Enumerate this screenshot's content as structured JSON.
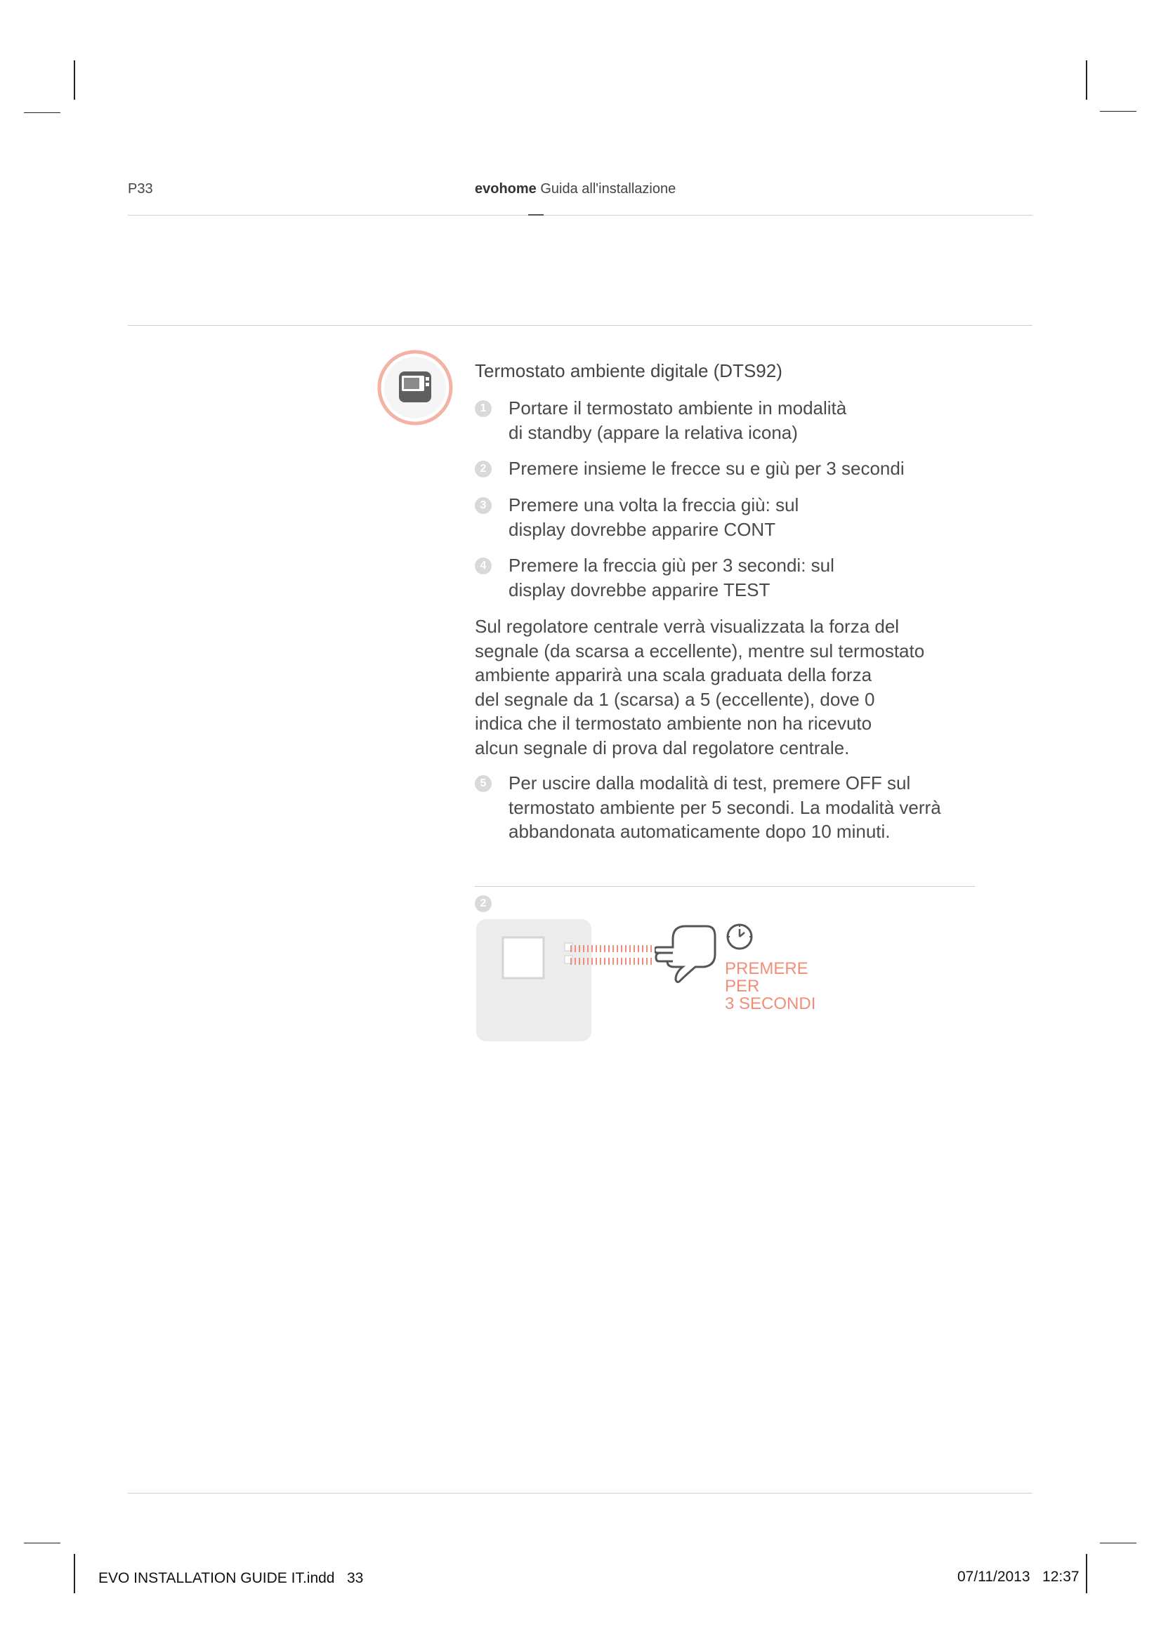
{
  "header": {
    "page_label": "P33",
    "brand": "evohome",
    "guide_title": "Guida all'installazione"
  },
  "section": {
    "icon": "thermostat-device-icon",
    "title": "Termostato ambiente digitale (DTS92)",
    "steps": [
      {
        "num": "1",
        "text": "Portare il termostato ambiente in modalità\ndi standby (appare la relativa icona)"
      },
      {
        "num": "2",
        "text": "Premere insieme le frecce su e giù per 3 secondi"
      },
      {
        "num": "3",
        "text": "Premere una volta la freccia giù: sul\ndisplay dovrebbe apparire CONT"
      },
      {
        "num": "4",
        "text": "Premere la freccia giù per 3 secondi: sul\ndisplay dovrebbe apparire TEST"
      }
    ],
    "paragraph": "Sul regolatore centrale verrà visualizzata la forza del\nsegnale (da scarsa a eccellente), mentre sul termostato\nambiente apparirà una scala graduata della forza\ndel segnale da 1 (scarsa) a 5 (eccellente), dove 0\nindica che il termostato ambiente non ha ricevuto\nalcun segnale di prova dal regolatore centrale.",
    "step5": {
      "num": "5",
      "text": "Per uscire dalla modalità di test, premere OFF sul\ntermostato ambiente per 5 secondi. La modalità verrà\nabbandonata automaticamente dopo 10 minuti."
    }
  },
  "figure": {
    "step_num": "2",
    "press_text": "PREMERE\nPER\n3 SECONDI",
    "accent_color": "#f08e7a"
  },
  "footer": {
    "file": "EVO INSTALLATION GUIDE IT.indd   33",
    "datetime": "07/11/2013   12:37"
  }
}
